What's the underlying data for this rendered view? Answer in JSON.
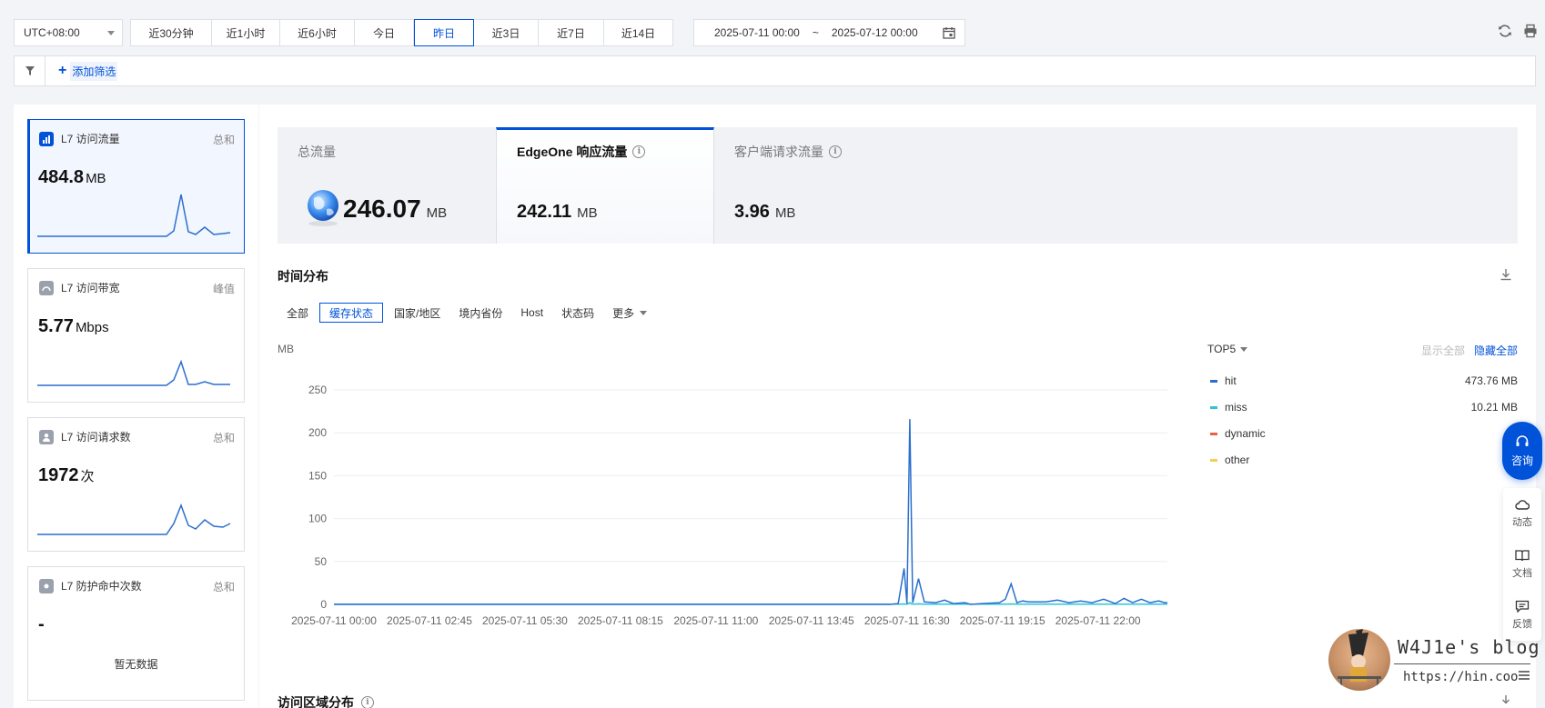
{
  "toolbar": {
    "timezone": "UTC+08:00",
    "ranges": [
      "近30分钟",
      "近1小时",
      "近6小时",
      "今日",
      "昨日",
      "近3日",
      "近7日",
      "近14日"
    ],
    "active_range": "昨日",
    "date_start": "2025-07-11 00:00",
    "date_sep": "~",
    "date_end": "2025-07-12 00:00"
  },
  "filter": {
    "add_label": "添加筛选"
  },
  "metrics": [
    {
      "title": "L7 访问流量",
      "agg": "总和",
      "value": "484.8",
      "unit": "MB",
      "active": true
    },
    {
      "title": "L7 访问带宽",
      "agg": "峰值",
      "value": "5.77",
      "unit": "Mbps"
    },
    {
      "title": "L7 访问请求数",
      "agg": "总和",
      "value": "1972",
      "unit": "次"
    },
    {
      "title": "L7 防护命中次数",
      "agg": "总和",
      "value": "-",
      "unit": "",
      "empty": "暂无数据"
    }
  ],
  "stats": [
    {
      "label": "总流量",
      "value": "246.07",
      "unit": "MB"
    },
    {
      "label": "EdgeOne 响应流量",
      "value": "242.11",
      "unit": "MB",
      "active": true
    },
    {
      "label": "客户端请求流量",
      "value": "3.96",
      "unit": "MB"
    }
  ],
  "section": {
    "time_dist": "时间分布",
    "region_dist": "访问区域分布"
  },
  "dim_tabs": [
    "全部",
    "缓存状态",
    "国家/地区",
    "境内省份",
    "Host",
    "状态码",
    "更多"
  ],
  "active_dim": "缓存状态",
  "legend": {
    "top": "TOP5",
    "show_all": "显示全部",
    "hide_all": "隐藏全部",
    "items": [
      {
        "name": "hit",
        "value": "473.76 MB",
        "color": "#2b6fce"
      },
      {
        "name": "miss",
        "value": "10.21 MB",
        "color": "#2bc4d8"
      },
      {
        "name": "dynamic",
        "value": "0",
        "color": "#e6643c"
      },
      {
        "name": "other",
        "value": "0",
        "color": "#f5d04a"
      }
    ]
  },
  "chart_data": {
    "type": "line",
    "ylabel": "MB",
    "ylim": [
      0,
      250
    ],
    "yticks": [
      0,
      50,
      100,
      150,
      200,
      250
    ],
    "xticks": [
      "2025-07-11 00:00",
      "2025-07-11 02:45",
      "2025-07-11 05:30",
      "2025-07-11 08:15",
      "2025-07-11 11:00",
      "2025-07-11 13:45",
      "2025-07-11 16:30",
      "2025-07-11 19:15",
      "2025-07-11 22:00"
    ],
    "x_minutes": [
      0,
      960,
      975,
      985,
      990,
      995,
      1000,
      1010,
      1020,
      1040,
      1055,
      1070,
      1090,
      1100,
      1120,
      1150,
      1160,
      1170,
      1180,
      1190,
      1200,
      1230,
      1250,
      1270,
      1290,
      1310,
      1330,
      1350,
      1365,
      1380,
      1395,
      1410,
      1425,
      1435
    ],
    "series": [
      {
        "name": "hit",
        "values": [
          0,
          0,
          1,
          42,
          1,
          216,
          2,
          30,
          3,
          2,
          5,
          1,
          2,
          0,
          1,
          2,
          6,
          24,
          2,
          4,
          3,
          3,
          5,
          2,
          4,
          2,
          6,
          1,
          7,
          2,
          6,
          2,
          4,
          2
        ]
      },
      {
        "name": "miss",
        "values": [
          0.3,
          0.3,
          0.3,
          0.5,
          0.3,
          2,
          0.3,
          0.6,
          0.3,
          0.3,
          0.3,
          0.3,
          0.3,
          0.3,
          0.3,
          0.3,
          0.3,
          0.5,
          0.3,
          0.3,
          0.3,
          0.3,
          0.3,
          0.3,
          0.3,
          0.3,
          0.3,
          0.3,
          0.3,
          0.3,
          0.3,
          0.3,
          0.3,
          0.3
        ]
      }
    ]
  },
  "floating": {
    "consult": "咨询",
    "tools": [
      "动态",
      "文档",
      "反馈"
    ]
  },
  "watermark": {
    "title": "W4J1e's blog",
    "url": "https://hin.coo"
  }
}
